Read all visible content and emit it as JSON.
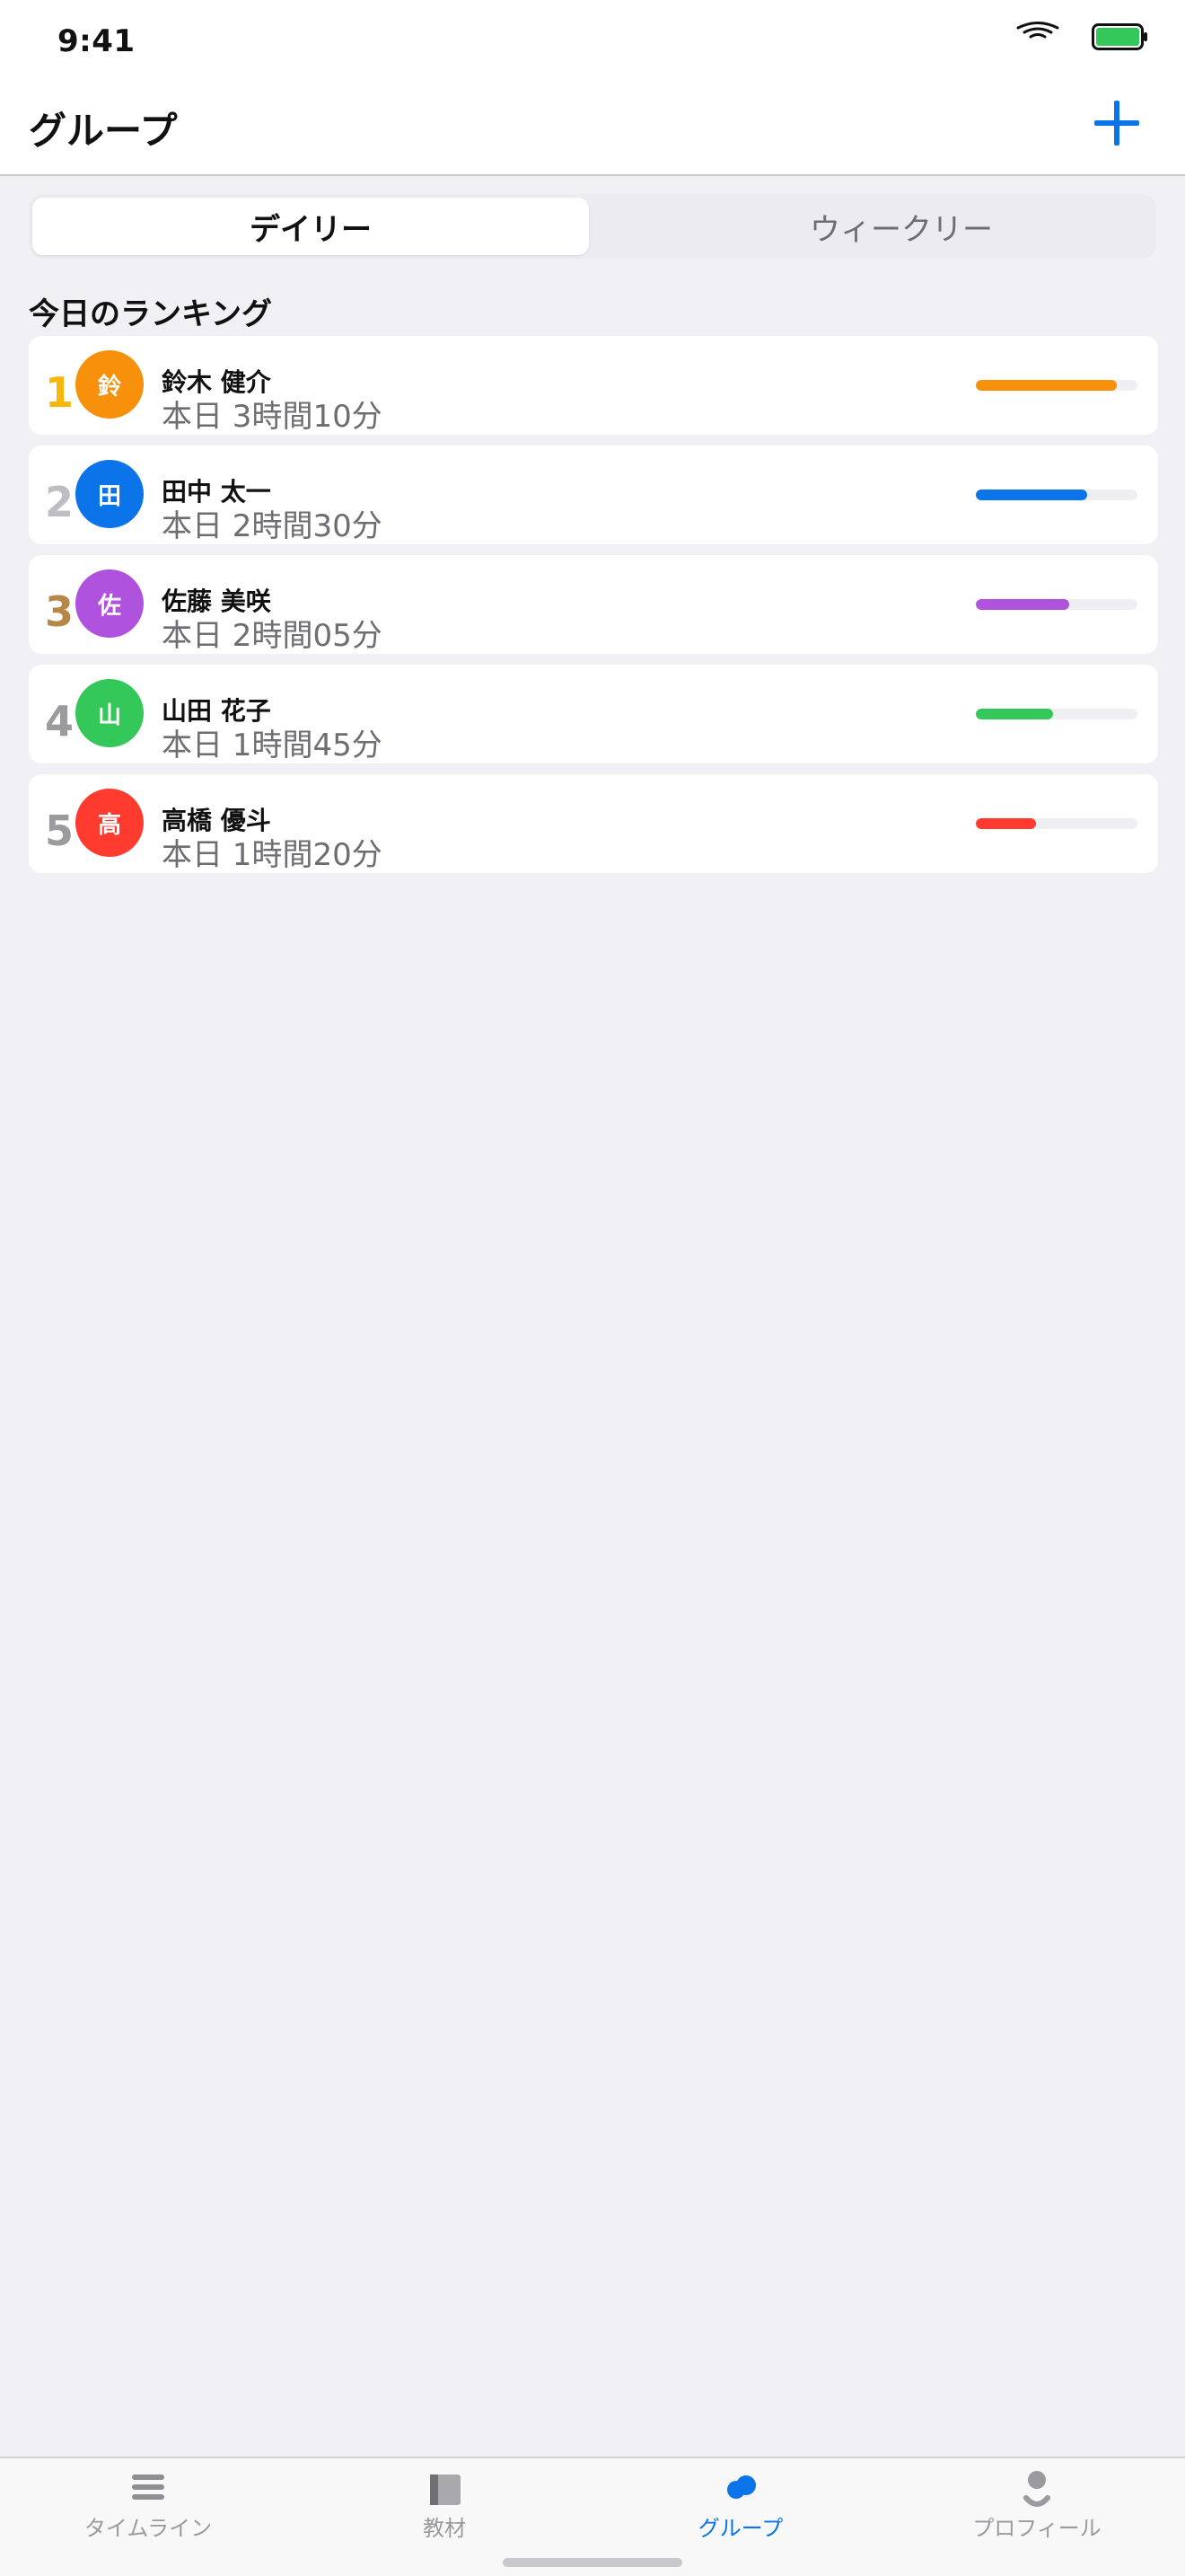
{
  "status": {
    "time": "9:41"
  },
  "nav": {
    "title": "グループ",
    "add_label": "+"
  },
  "segments": {
    "daily": "デイリー",
    "weekly": "ウィークリー"
  },
  "section": {
    "title": "今日のランキング"
  },
  "ranking": [
    {
      "rank": "1",
      "initial": "鈴",
      "name": "鈴木 健介",
      "time": "本日 3時間10分",
      "progress": 0.87,
      "color": "#F7900A",
      "rank_color": "#F5B70A"
    },
    {
      "rank": "2",
      "initial": "田",
      "name": "田中 太一",
      "time": "本日 2時間30分",
      "progress": 0.69,
      "color": "#0A74E8",
      "rank_color": "#BDBDC2"
    },
    {
      "rank": "3",
      "initial": "佐",
      "name": "佐藤 美咲",
      "time": "本日 2時間05分",
      "progress": 0.58,
      "color": "#AF52DE",
      "rank_color": "#B7874A"
    },
    {
      "rank": "4",
      "initial": "山",
      "name": "山田 花子",
      "time": "本日 1時間45分",
      "progress": 0.48,
      "color": "#34C759",
      "rank_color": "#9A9A9F"
    },
    {
      "rank": "5",
      "initial": "高",
      "name": "高橋 優斗",
      "time": "本日 1時間20分",
      "progress": 0.37,
      "color": "#FF3B30",
      "rank_color": "#9A9A9F"
    }
  ],
  "tabs": [
    {
      "label": "タイムライン",
      "icon": "list-icon",
      "active": false
    },
    {
      "label": "教材",
      "icon": "book-icon",
      "active": false
    },
    {
      "label": "グループ",
      "icon": "group-icon",
      "active": true
    },
    {
      "label": "プロフィール",
      "icon": "person-icon",
      "active": false
    }
  ],
  "colors": {
    "accent": "#0A74E8",
    "battery": "#34C759"
  }
}
